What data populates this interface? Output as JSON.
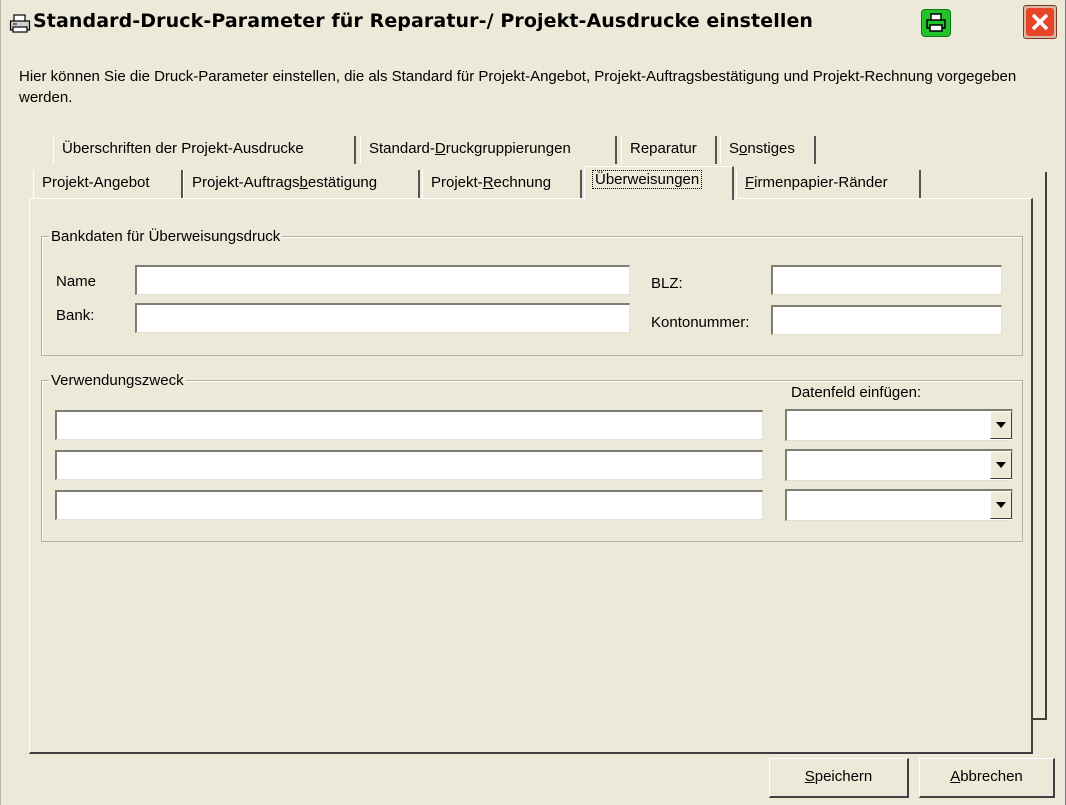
{
  "window": {
    "title": "Standard-Druck-Parameter für Reparatur-/ Projekt-Ausdrucke einstellen",
    "icons": [
      "printer-icon",
      "print-button-icon",
      "close-icon"
    ],
    "colors": {
      "print_button": "#22c22a",
      "close_button": "#d9b7a3",
      "background": "#ece9d8"
    }
  },
  "description": "Hier können Sie die Druck-Parameter einstellen, die als Standard für Projekt-Angebot, Projekt-Auftragsbestätigung und Projekt-Rechnung vorgegeben werden.",
  "tabs_back": [
    {
      "pre": "Überschriften der Projekt-Ausdrucke",
      "key": "",
      "post": ""
    },
    {
      "pre": "Standard-",
      "key": "D",
      "post": "ruckgruppierungen"
    },
    {
      "pre": "Reparatur",
      "key": "",
      "post": ""
    },
    {
      "pre": "S",
      "key": "o",
      "post": "nstiges"
    }
  ],
  "tabs_front": [
    {
      "pre": "Projekt-Angebot",
      "key": "",
      "post": ""
    },
    {
      "pre": "Projekt-Auftrags",
      "key": "b",
      "post": "estätigung"
    },
    {
      "pre": "Projekt-",
      "key": "R",
      "post": "echnung"
    },
    {
      "pre": "Überweisungen",
      "key": "",
      "post": "",
      "active": true
    },
    {
      "pre": "",
      "key": "F",
      "post": "irmenpapier-Ränder"
    }
  ],
  "bank": {
    "legend": "Bankdaten für Überweisungsdruck",
    "name_label": "Name",
    "name_value": "",
    "bank_label": "Bank:",
    "bank_value": "",
    "blz_label": "BLZ:",
    "blz_value": "",
    "konto_label": "Kontonummer:",
    "konto_value": ""
  },
  "purpose": {
    "legend": "Verwendungszweck",
    "datenfeld_label": "Datenfeld einfügen:",
    "lines": [
      "",
      "",
      ""
    ],
    "datenfeld_selected": [
      "",
      "",
      ""
    ]
  },
  "buttons": {
    "save": {
      "key": "S",
      "post": "peichern"
    },
    "cancel": {
      "key": "A",
      "post": "bbrechen"
    }
  }
}
